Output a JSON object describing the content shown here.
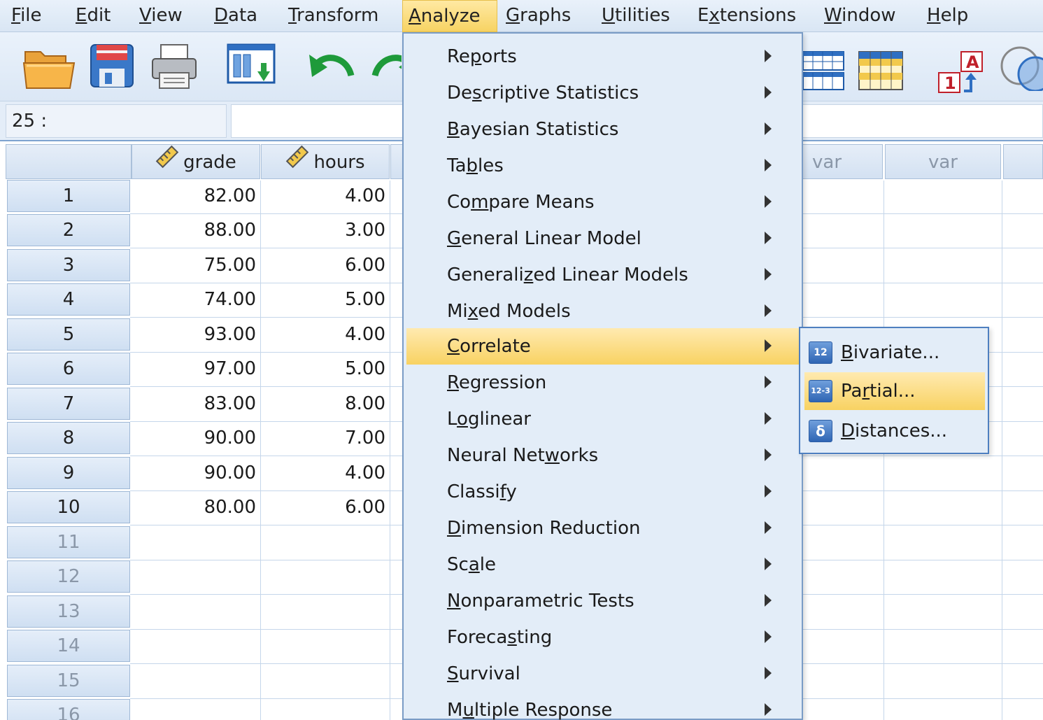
{
  "menubar": {
    "items": [
      {
        "pre": "",
        "u": "F",
        "post": "ile"
      },
      {
        "pre": "",
        "u": "E",
        "post": "dit"
      },
      {
        "pre": "",
        "u": "V",
        "post": "iew"
      },
      {
        "pre": "",
        "u": "D",
        "post": "ata"
      },
      {
        "pre": "",
        "u": "T",
        "post": "ransform"
      },
      {
        "pre": "",
        "u": "A",
        "post": "nalyze"
      },
      {
        "pre": "",
        "u": "G",
        "post": "raphs"
      },
      {
        "pre": "",
        "u": "U",
        "post": "tilities"
      },
      {
        "pre": "E",
        "u": "x",
        "post": "tensions"
      },
      {
        "pre": "",
        "u": "W",
        "post": "indow"
      },
      {
        "pre": "",
        "u": "H",
        "post": "elp"
      }
    ],
    "active": "Analyze"
  },
  "toolbar": {
    "icons": [
      "open-folder-icon",
      "save-icon",
      "print-icon",
      "dialog-recall-icon",
      "undo-icon",
      "redo-icon",
      "insert-cases-icon",
      "split-file-icon",
      "value-labels-icon",
      "use-variable-sets-icon"
    ]
  },
  "cell_editor": {
    "reference": "25 :",
    "value": ""
  },
  "grid": {
    "columns": [
      {
        "name": "grade",
        "type": "scale"
      },
      {
        "name": "hours",
        "type": "scale"
      },
      {
        "name": "var"
      },
      {
        "name": "var"
      }
    ],
    "rows": [
      {
        "n": "1",
        "grade": "82.00",
        "hours": "4.00"
      },
      {
        "n": "2",
        "grade": "88.00",
        "hours": "3.00"
      },
      {
        "n": "3",
        "grade": "75.00",
        "hours": "6.00"
      },
      {
        "n": "4",
        "grade": "74.00",
        "hours": "5.00"
      },
      {
        "n": "5",
        "grade": "93.00",
        "hours": "4.00"
      },
      {
        "n": "6",
        "grade": "97.00",
        "hours": "5.00"
      },
      {
        "n": "7",
        "grade": "83.00",
        "hours": "8.00"
      },
      {
        "n": "8",
        "grade": "90.00",
        "hours": "7.00"
      },
      {
        "n": "9",
        "grade": "90.00",
        "hours": "4.00"
      },
      {
        "n": "10",
        "grade": "80.00",
        "hours": "6.00"
      },
      {
        "n": "11",
        "grade": "",
        "hours": ""
      },
      {
        "n": "12",
        "grade": "",
        "hours": ""
      },
      {
        "n": "13",
        "grade": "",
        "hours": ""
      },
      {
        "n": "14",
        "grade": "",
        "hours": ""
      },
      {
        "n": "15",
        "grade": "",
        "hours": ""
      },
      {
        "n": "16",
        "grade": "",
        "hours": ""
      }
    ]
  },
  "analyze_menu": {
    "items": [
      {
        "pre": "Re",
        "u": "p",
        "post": "orts"
      },
      {
        "pre": "De",
        "u": "s",
        "post": "criptive Statistics"
      },
      {
        "pre": "",
        "u": "B",
        "post": "ayesian Statistics"
      },
      {
        "pre": "Ta",
        "u": "b",
        "post": "les"
      },
      {
        "pre": "Co",
        "u": "m",
        "post": "pare Means"
      },
      {
        "pre": "",
        "u": "G",
        "post": "eneral Linear Model"
      },
      {
        "pre": "Generali",
        "u": "z",
        "post": "ed Linear Models"
      },
      {
        "pre": "Mi",
        "u": "x",
        "post": "ed Models"
      },
      {
        "pre": "",
        "u": "C",
        "post": "orrelate"
      },
      {
        "pre": "",
        "u": "R",
        "post": "egression"
      },
      {
        "pre": "L",
        "u": "o",
        "post": "glinear"
      },
      {
        "pre": "Neural Net",
        "u": "w",
        "post": "orks"
      },
      {
        "pre": "Classi",
        "u": "f",
        "post": "y"
      },
      {
        "pre": "",
        "u": "D",
        "post": "imension Reduction"
      },
      {
        "pre": "Sc",
        "u": "a",
        "post": "le"
      },
      {
        "pre": "",
        "u": "N",
        "post": "onparametric Tests"
      },
      {
        "pre": "Foreca",
        "u": "s",
        "post": "ting"
      },
      {
        "pre": "",
        "u": "S",
        "post": "urvival"
      },
      {
        "pre": "M",
        "u": "u",
        "post": "ltiple Response"
      }
    ],
    "highlighted": "Correlate"
  },
  "correlate_submenu": {
    "items": [
      {
        "pre": "",
        "u": "B",
        "post": "ivariate...",
        "icon": "bivariate-icon",
        "icon_text": "12"
      },
      {
        "pre": "Pa",
        "u": "r",
        "post": "tial...",
        "icon": "partial-icon",
        "icon_text": "12-3"
      },
      {
        "pre": "",
        "u": "D",
        "post": "istances...",
        "icon": "distances-icon",
        "icon_text": "δ"
      }
    ],
    "highlighted": "Partial..."
  },
  "colors": {
    "menu_highlight": "#f8d262",
    "menu_bg": "#e3edf8",
    "grid_line": "#c5d6ea"
  }
}
